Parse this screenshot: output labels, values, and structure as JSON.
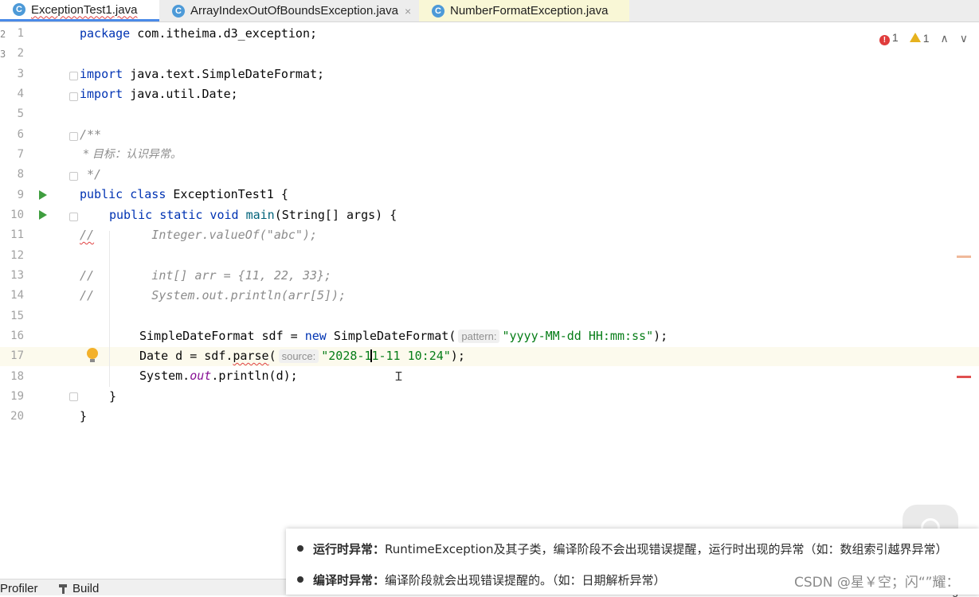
{
  "tabs": [
    {
      "label": "ExceptionTest1.java",
      "icon": "class-icon",
      "active": true
    },
    {
      "label": "ArrayIndexOutOfBoundsException.java",
      "icon": "class-icon",
      "active": false
    },
    {
      "label": "NumberFormatException.java",
      "icon": "class-icon",
      "active": false
    }
  ],
  "tab_close_glyph": "×",
  "inspection": {
    "errors": "1",
    "warnings": "1"
  },
  "line_numbers": [
    "1",
    "2",
    "3",
    "4",
    "5",
    "6",
    "7",
    "8",
    "9",
    "10",
    "11",
    "12",
    "13",
    "14",
    "15",
    "16",
    "17",
    "18",
    "19",
    "20"
  ],
  "side_marks": [
    "2",
    "3"
  ],
  "code": {
    "l1": {
      "kw": "package",
      "rest": " com.itheima.d3_exception;"
    },
    "l3": {
      "kw": "import",
      "rest": " java.text.SimpleDateFormat;"
    },
    "l4": {
      "kw": "import",
      "rest": " java.util.Date;"
    },
    "l6": "/**",
    "l7": " * 目标：认识异常。",
    "l8": " */",
    "l9": {
      "kw": "public class",
      "rest": " ExceptionTest1 {"
    },
    "l10": {
      "kw": "public static void",
      "fn": "main",
      "rest": "(String[] args) {"
    },
    "l11": {
      "prefix": "//",
      "body": "        Integer.valueOf(\"abc\");"
    },
    "l13": {
      "prefix": "//",
      "body": "        int[] arr = {11, 22, 33};"
    },
    "l14": {
      "prefix": "//",
      "body": "        System.out.println(arr[5]);"
    },
    "l16": {
      "a": "SimpleDateFormat sdf = ",
      "kw": "new",
      "b": " SimpleDateFormat(",
      "hint": "pattern:",
      "str": "\"yyyy-MM-dd HH:mm:ss\"",
      "c": ");"
    },
    "l17": {
      "a": "Date d = sdf.",
      "method": "parse",
      "b": "(",
      "hint": "source:",
      "str1": "\"2028-1",
      "str2": "1-11 10:24\"",
      "c": ");"
    },
    "l18": {
      "a": "System.",
      "field": "out",
      "b": ".println(d);"
    },
    "l19": "}",
    "l20": "}"
  },
  "statusbar": {
    "profiler": "Profiler",
    "build": "Build",
    "event_log": "Event Log"
  },
  "overlay": {
    "row1_title": "运行时异常：",
    "row1_text": "RuntimeException及其子类，编译阶段不会出现错误提醒，运行时出现的异常（如：数组索引越界异常）",
    "row2_title": "编译时异常：",
    "row2_text": "编译阶段就会出现错误提醒的。（如：日期解析异常）"
  },
  "watermark": "CSDN @星￥空；闪“”耀：",
  "colors": {
    "keyword": "#0033b3",
    "string": "#067d17",
    "comment": "#8c8c8c",
    "error": "#e03c3c",
    "warning": "#e6b21e",
    "tab_accent": "#4a8ae8"
  }
}
